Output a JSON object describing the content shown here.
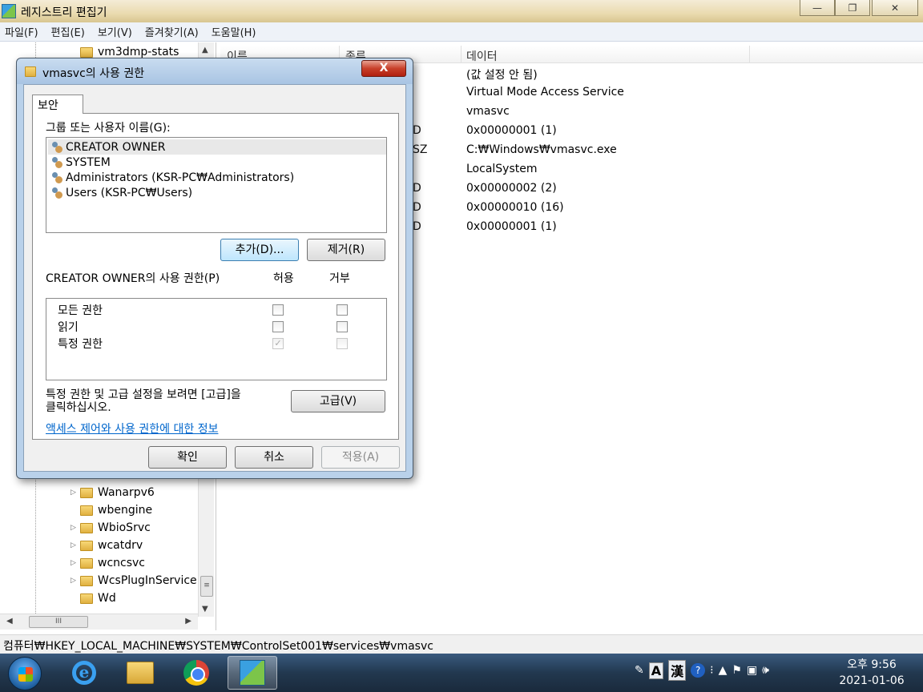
{
  "window": {
    "title": "레지스트리 편집기",
    "minimize": "—",
    "maximize": "❐",
    "close": "✕"
  },
  "menu": [
    "파일(F)",
    "편집(E)",
    "보기(V)",
    "즐겨찾기(A)",
    "도움말(H)"
  ],
  "tree": {
    "items": [
      {
        "label": "vm3dmp-stats",
        "expandable": false
      },
      {
        "label": "Wanarpv6",
        "expandable": true
      },
      {
        "label": "wbengine",
        "expandable": false
      },
      {
        "label": "WbioSrvc",
        "expandable": true
      },
      {
        "label": "wcatdrv",
        "expandable": true
      },
      {
        "label": "wcncsvc",
        "expandable": true
      },
      {
        "label": "WcsPlugInService",
        "expandable": true
      },
      {
        "label": "Wd",
        "expandable": false
      }
    ],
    "scroll_up": "▲",
    "scroll_down": "▼",
    "scroll_left": "◀",
    "scroll_right": "▶",
    "grip": "≡",
    "hgrip": "III"
  },
  "values": {
    "columns": [
      "이름",
      "종류",
      "데이터"
    ],
    "rows": [
      {
        "type": "",
        "data": "(값 설정 안 됨)"
      },
      {
        "type": "",
        "data": "Virtual Mode Access Service"
      },
      {
        "type": "",
        "data": "vmasvc"
      },
      {
        "type": "D",
        "data": "0x00000001 (1)"
      },
      {
        "type": "SZ",
        "data": "C:₩Windows₩vmasvc.exe"
      },
      {
        "type": "",
        "data": "LocalSystem"
      },
      {
        "type": "D",
        "data": "0x00000002 (2)"
      },
      {
        "type": "D",
        "data": "0x00000010 (16)"
      },
      {
        "type": "D",
        "data": "0x00000001 (1)"
      }
    ]
  },
  "status_path": "컴퓨터₩HKEY_LOCAL_MACHINE₩SYSTEM₩ControlSet001₩services₩vmasvc",
  "dialog": {
    "title": "vmasvc의 사용 권한",
    "close": "X",
    "tab": "보안",
    "users_label": "그룹 또는 사용자 이름(G):",
    "users": [
      "CREATOR OWNER",
      "SYSTEM",
      "Administrators (KSR-PC₩Administrators)",
      "Users (KSR-PC₩Users)"
    ],
    "add_button": "추가(D)...",
    "remove_button": "제거(R)",
    "perm_label": "CREATOR OWNER의 사용 권한(P)",
    "allow_header": "허용",
    "deny_header": "거부",
    "permissions": [
      {
        "name": "모든 권한",
        "allow": false,
        "deny": false,
        "disabled": false
      },
      {
        "name": "읽기",
        "allow": false,
        "deny": false,
        "disabled": false
      },
      {
        "name": "특정 권한",
        "allow": true,
        "deny": false,
        "disabled": true
      }
    ],
    "advanced_hint": "특정 권한 및 고급 설정을 보려면 [고급]을\n클릭하십시오.",
    "advanced_button": "고급(V)",
    "help_link": "액세스 제어와 사용 권한에 대한 정보",
    "ok_button": "확인",
    "cancel_button": "취소",
    "apply_button": "적용(A)"
  },
  "taskbar": {
    "ie_glyph": "e",
    "tray": {
      "ime_mode": "A",
      "ime_hanja": "漢",
      "help": "?"
    },
    "clock_time": "오후 9:56",
    "clock_date": "2021-01-06"
  }
}
